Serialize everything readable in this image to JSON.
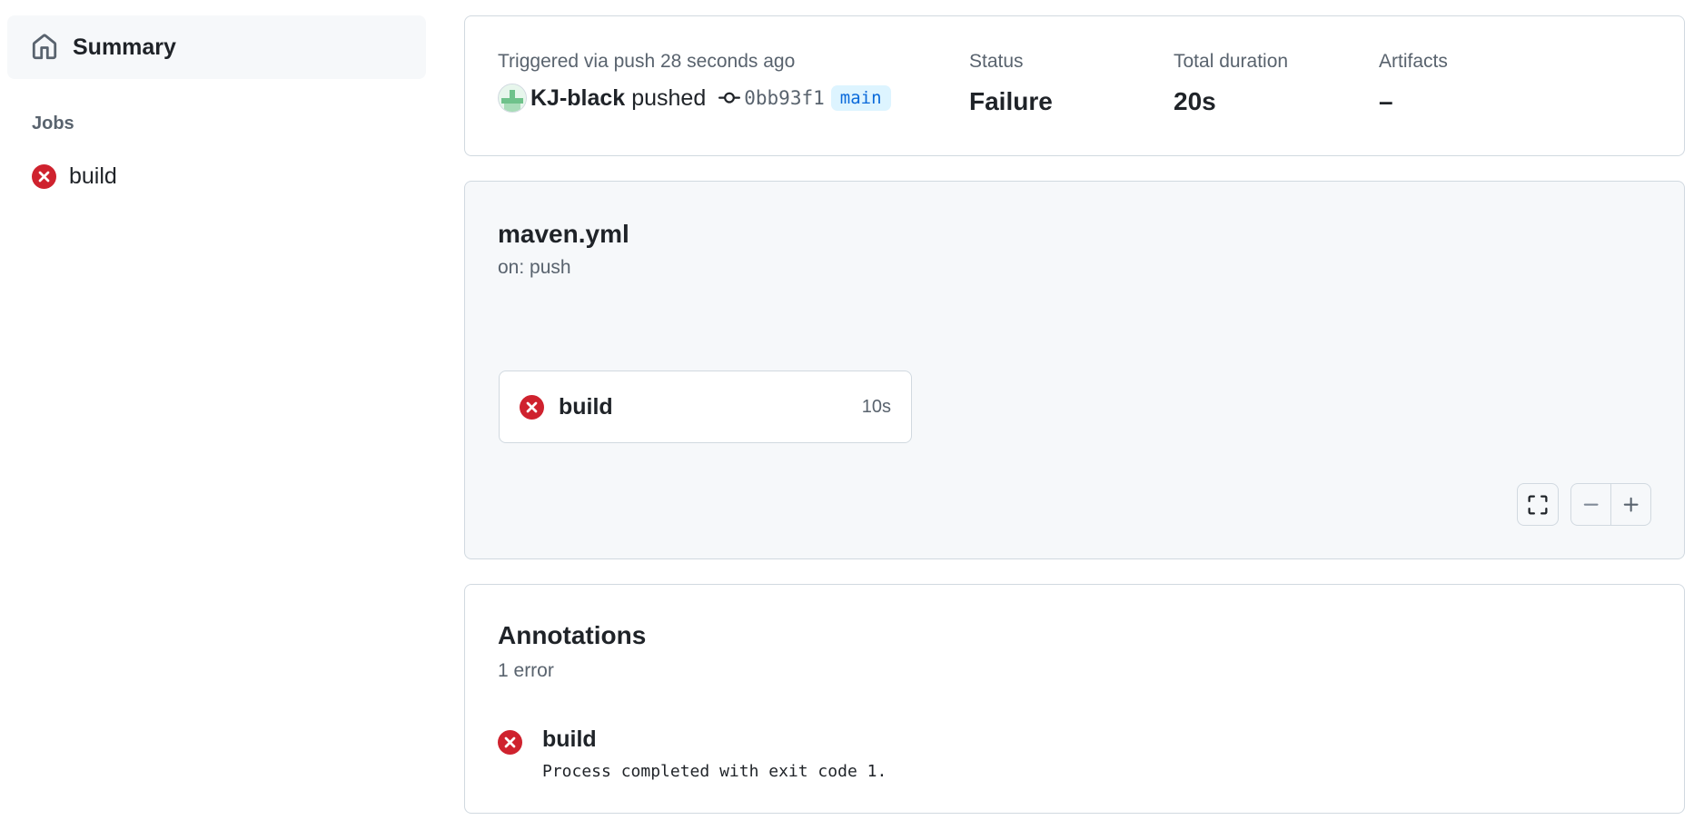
{
  "sidebar": {
    "summary_label": "Summary",
    "jobs_heading": "Jobs",
    "jobs": [
      {
        "name": "build",
        "status": "failure"
      }
    ]
  },
  "run": {
    "trigger_text": "Triggered via push 28 seconds ago",
    "actor": "KJ-black",
    "action": "pushed",
    "commit_sha": "0bb93f1",
    "branch": "main",
    "status_label": "Status",
    "status_value": "Failure",
    "duration_label": "Total duration",
    "duration_value": "20s",
    "artifacts_label": "Artifacts",
    "artifacts_value": "–"
  },
  "workflow": {
    "file": "maven.yml",
    "trigger": "on: push",
    "job": {
      "name": "build",
      "duration": "10s",
      "status": "failure"
    }
  },
  "annotations": {
    "title": "Annotations",
    "count_text": "1 error",
    "items": [
      {
        "job": "build",
        "message": "Process completed with exit code 1.",
        "level": "error"
      }
    ]
  },
  "colors": {
    "error": "#cf222e",
    "accent": "#0969da",
    "muted": "#59636e",
    "border": "#d1d9e0",
    "canvas_subtle": "#f6f8fa"
  },
  "icons": {
    "summary": "home-icon",
    "job_status": "x-circle-fill-icon",
    "commit": "git-commit-icon",
    "fullscreen": "screen-full-icon",
    "zoom_out": "dash-icon",
    "zoom_in": "plus-icon"
  }
}
